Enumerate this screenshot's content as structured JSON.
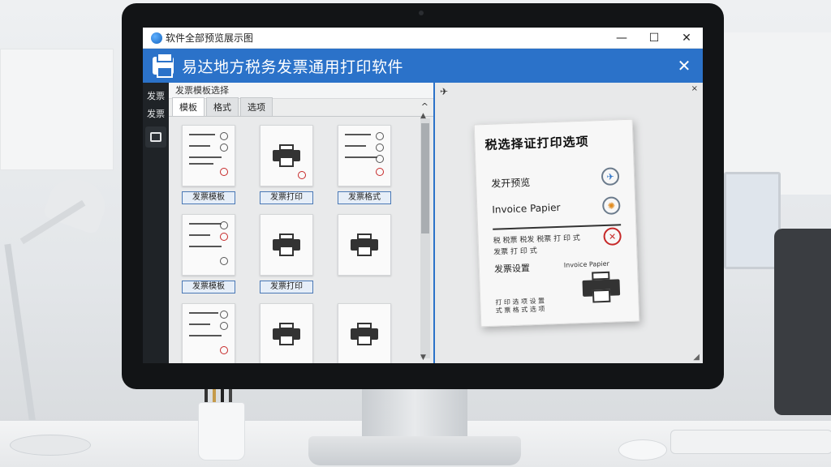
{
  "window": {
    "title": "软件全部预览展示图",
    "min_icon": "—",
    "max_icon": "☐",
    "close_icon": "✕"
  },
  "banner": {
    "title": "易达地方税务发票通用打印软件",
    "close_icon": "✕"
  },
  "sidebar": {
    "items": [
      {
        "label": "发票"
      },
      {
        "label": "发票"
      }
    ]
  },
  "left_panel": {
    "title": "发票模板选择",
    "tabs": [
      {
        "label": "模板",
        "active": true
      },
      {
        "label": "格式",
        "active": false
      },
      {
        "label": "选项",
        "active": false
      }
    ],
    "caret": "^",
    "cards": [
      {
        "type": "invoice",
        "label": "发票模板"
      },
      {
        "type": "printer",
        "label": "发票打印"
      },
      {
        "type": "invoice",
        "label": "发票格式"
      },
      {
        "type": "invoice",
        "label": "发票模板"
      },
      {
        "type": "printer",
        "label": "发票打印"
      },
      {
        "type": "printer",
        "label": ""
      },
      {
        "type": "invoice",
        "label": ""
      },
      {
        "type": "printer",
        "label": ""
      },
      {
        "type": "printer",
        "label": ""
      }
    ]
  },
  "right_panel": {
    "pin_icon": "✈",
    "close_icon": "×",
    "resize_grip": "◢",
    "invoice": {
      "title": "税选择证打印选项",
      "row1": "发开预览",
      "row2": "Invoice Papier",
      "row3": "发票设置",
      "row3b": "Invoice Papier",
      "small1": "税 税票 税发 税票 打 印 式",
      "small2": "发票 打 印 式",
      "small3": "打 印 选 项 设 置",
      "small4": "式 票 格 式 选 项"
    }
  }
}
